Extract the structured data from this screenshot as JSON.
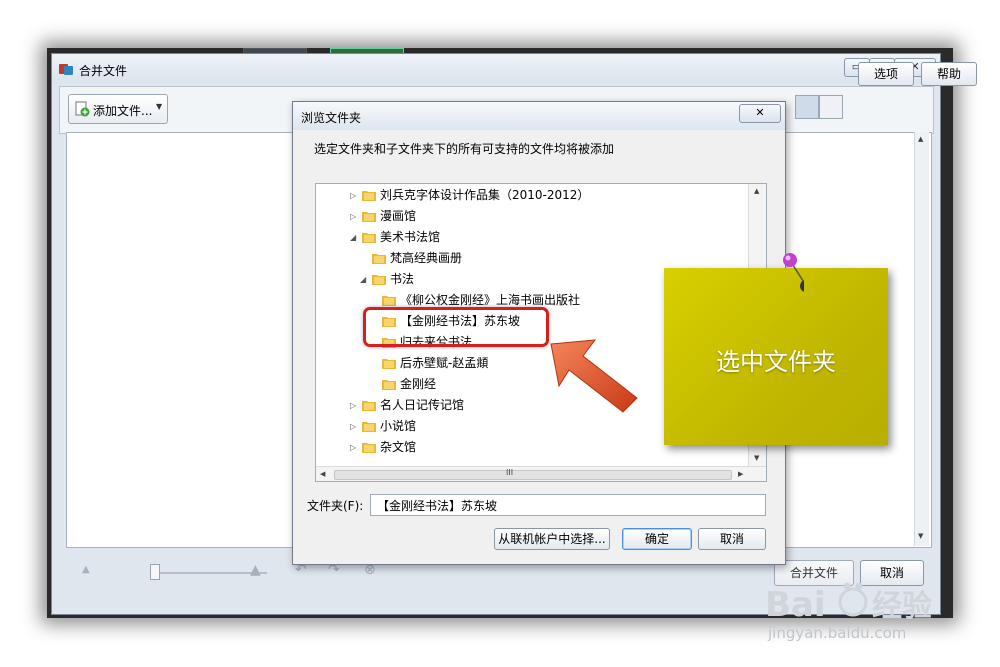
{
  "background_thumbs": [],
  "main_window": {
    "title": "合并文件",
    "window_buttons": {
      "minimize": "▭",
      "maximize": "▢",
      "close": "✕"
    },
    "toolbar": {
      "add_files": "添加文件...",
      "options": "选项",
      "help": "帮助"
    },
    "footer": {
      "merge": "合并文件",
      "cancel": "取消"
    }
  },
  "dialog": {
    "title": "浏览文件夹",
    "close": "✕",
    "instruction": "选定文件夹和子文件夹下的所有可支持的文件均将被添加",
    "tree": [
      {
        "label": "刘兵克字体设计作品集（2010-2012）",
        "level": 0,
        "arrow": "▷"
      },
      {
        "label": "漫画馆",
        "level": 0,
        "arrow": "▷"
      },
      {
        "label": "美术书法馆",
        "level": 0,
        "arrow": "◢"
      },
      {
        "label": "梵高经典画册",
        "level": 1,
        "arrow": ""
      },
      {
        "label": "书法",
        "level": 1,
        "arrow": "◢"
      },
      {
        "label": "《柳公权金刚经》上海书画出版社",
        "level": 2,
        "arrow": ""
      },
      {
        "label": "【金刚经书法】苏东坡",
        "level": 2,
        "arrow": "",
        "selected": true
      },
      {
        "label": "归去来兮书法",
        "level": 2,
        "arrow": ""
      },
      {
        "label": "后赤壁赋-赵孟頫",
        "level": 2,
        "arrow": ""
      },
      {
        "label": "金刚经",
        "level": 2,
        "arrow": ""
      },
      {
        "label": "名人日记传记馆",
        "level": 0,
        "arrow": "▷"
      },
      {
        "label": "小说馆",
        "level": 0,
        "arrow": "▷"
      },
      {
        "label": "杂文馆",
        "level": 0,
        "arrow": "▷"
      }
    ],
    "scroll": {
      "up": "▲",
      "down": "▼",
      "left": "◀",
      "right": "▶",
      "grip": "III"
    },
    "folder_label": "文件夹(F):",
    "folder_value": "【金刚经书法】苏东坡",
    "buttons": {
      "account": "从联机帐户中选择...",
      "ok": "确定",
      "cancel": "取消"
    }
  },
  "annotation": {
    "note_text": "选中文件夹",
    "note_color": "#ccc300",
    "highlight_color": "#d4201f",
    "arrow_color": "#e0522a"
  },
  "watermark": {
    "text": "jingyan.baidu.com"
  }
}
